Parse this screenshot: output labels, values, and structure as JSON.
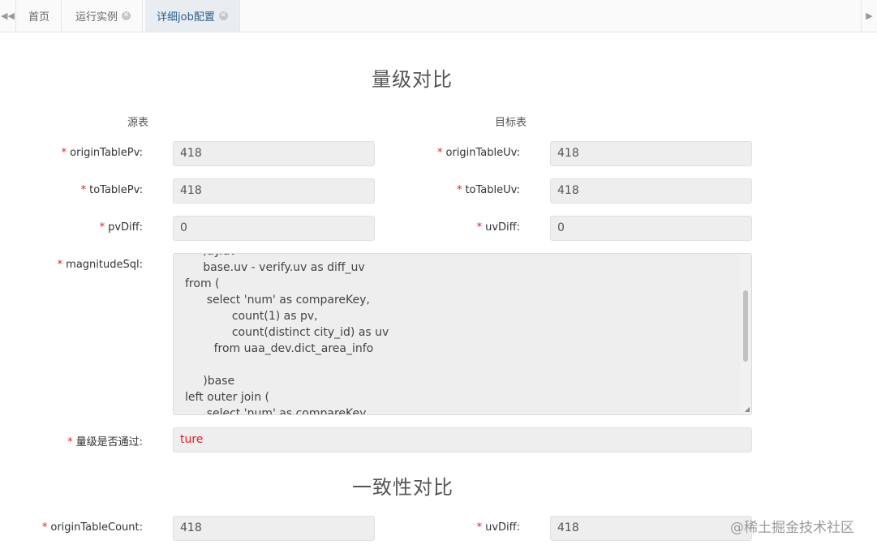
{
  "tabs": [
    {
      "label": "首页",
      "closable": false,
      "active": false
    },
    {
      "label": "运行实例",
      "closable": true,
      "active": false
    },
    {
      "label": "详细job配置",
      "closable": true,
      "active": true
    }
  ],
  "icons": {
    "nav_left": "double-chevron-left-icon",
    "nav_right": "chevron-right-icon",
    "close": "close-circle-icon"
  },
  "magnitude": {
    "title": "量级对比",
    "source_header": "源表",
    "target_header": "目标表",
    "fields": {
      "originTablePv": {
        "label": "originTablePv:",
        "value": "418"
      },
      "originTableUv": {
        "label": "originTableUv:",
        "value": "418"
      },
      "toTablePv": {
        "label": "toTablePv:",
        "value": "418"
      },
      "toTableUv": {
        "label": "toTableUv:",
        "value": "418"
      },
      "pvDiff": {
        "label": "pvDiff:",
        "value": "0"
      },
      "uvDiff": {
        "label": "uvDiff:",
        "value": "0"
      }
    },
    "sql": {
      "label": "magnitudeSql:",
      "lines": [
        "     ,uy.uv",
        "     base.uv - verify.uv as diff_uv",
        "from (",
        "      select 'num' as compareKey,",
        "             count(1) as pv,",
        "             count(distinct city_id) as uv",
        "        from uaa_dev.dict_area_info",
        "",
        "     )base",
        "left outer join (",
        "      select 'num' as compareKey,"
      ]
    },
    "pass": {
      "label": "量级是否通过:",
      "value": "ture"
    }
  },
  "consistency": {
    "title": "一致性对比",
    "fields": {
      "originTableCount": {
        "label": "originTableCount:",
        "value": "418"
      },
      "uvDiff": {
        "label": "uvDiff:",
        "value": "418"
      }
    }
  },
  "required_marker": "*",
  "watermark": "@稀土掘金技术社区"
}
